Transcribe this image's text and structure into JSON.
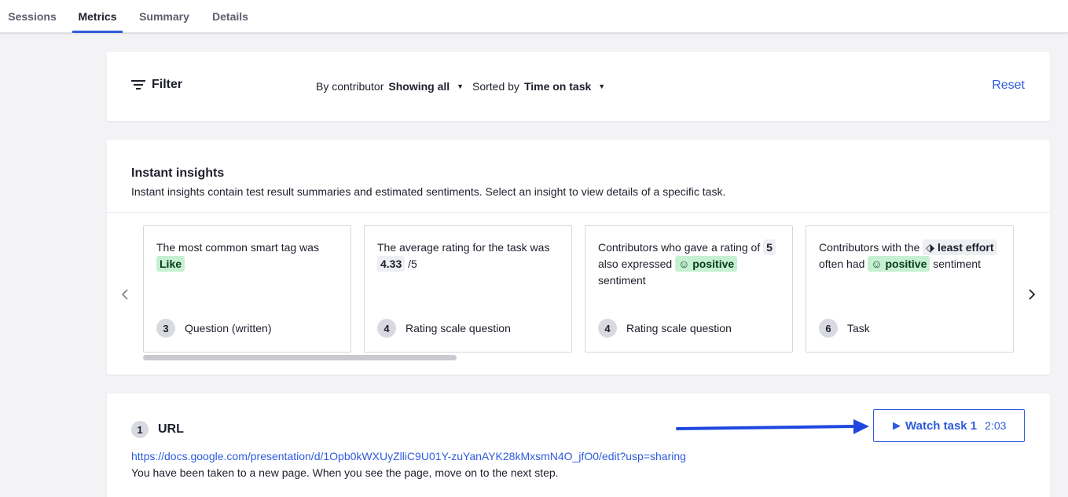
{
  "tabs": [
    {
      "label": "Sessions",
      "active": false
    },
    {
      "label": "Metrics",
      "active": true
    },
    {
      "label": "Summary",
      "active": false
    },
    {
      "label": "Details",
      "active": false
    }
  ],
  "filter": {
    "label": "Filter",
    "contributor_label": "By contributor",
    "contributor_value": "Showing all",
    "sort_label": "Sorted by",
    "sort_value": "Time on task",
    "reset_label": "Reset"
  },
  "insights": {
    "title": "Instant insights",
    "subtitle": "Instant insights contain test result summaries and estimated sentiments. Select an insight to view details of a specific task.",
    "cards": [
      {
        "text_before": "The most common smart tag was",
        "highlight": "Like",
        "number": "3",
        "task_type": "Question (written)"
      },
      {
        "text_before": "The average rating for the task was",
        "rating_value": "4.33",
        "rating_scale": "/5",
        "number": "4",
        "task_type": "Rating scale question"
      },
      {
        "text_before": "Contributors who gave a rating of",
        "rating_value": "5",
        "text_middle": "also expressed",
        "sentiment": "positive",
        "text_after": "sentiment",
        "number": "4",
        "task_type": "Rating scale question"
      },
      {
        "text_before": "Contributors with the",
        "effort_tag": "least effort",
        "text_middle": "often had",
        "sentiment": "positive",
        "text_after": "sentiment",
        "number": "6",
        "task_type": "Task"
      }
    ]
  },
  "task": {
    "number": "1",
    "title": "URL",
    "link": "https://docs.google.com/presentation/d/1Opb0kWXUyZlliC9U01Y-zuYanAYK28kMxsmN4O_jfO0/edit?usp=sharing",
    "description": "You have been taken to a new page. When you see the page, move on to the next step.",
    "watch_label": "Watch task 1",
    "watch_duration": "2:03"
  },
  "colors": {
    "accent": "#2f5bdd",
    "annotation_arrow": "#1f47e0",
    "positive_bg": "#c6f0d2",
    "page_bg": "#f3f3f6"
  }
}
